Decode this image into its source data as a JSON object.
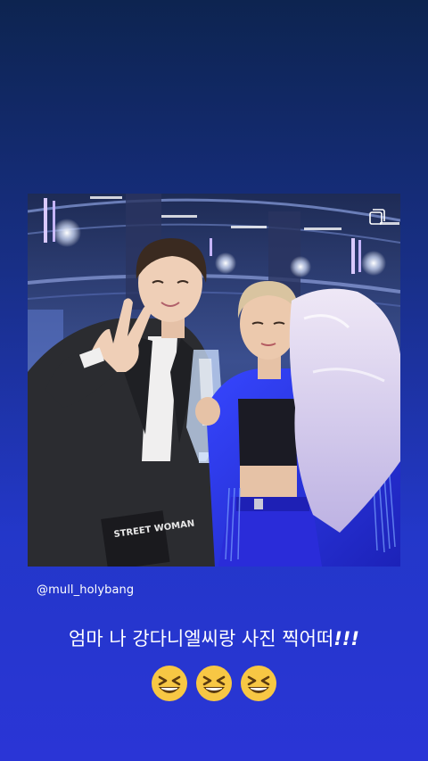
{
  "post": {
    "username": "@mull_holybang",
    "multi_photo_icon": "multiple-photos-icon"
  },
  "caption": {
    "text": "엄마 나 강다니엘씨랑 사진 찍어떠",
    "emphasis": "!!!"
  },
  "emojis": [
    "grinning-squinting-face-icon",
    "grinning-squinting-face-icon",
    "grinning-squinting-face-icon"
  ],
  "photo": {
    "trophy_text": "STREET WOMAN"
  },
  "colors": {
    "background_top": "#0d2450",
    "background_bottom": "#2a35d6",
    "text": "#ffffff",
    "emoji_yellow": "#f7c744"
  }
}
